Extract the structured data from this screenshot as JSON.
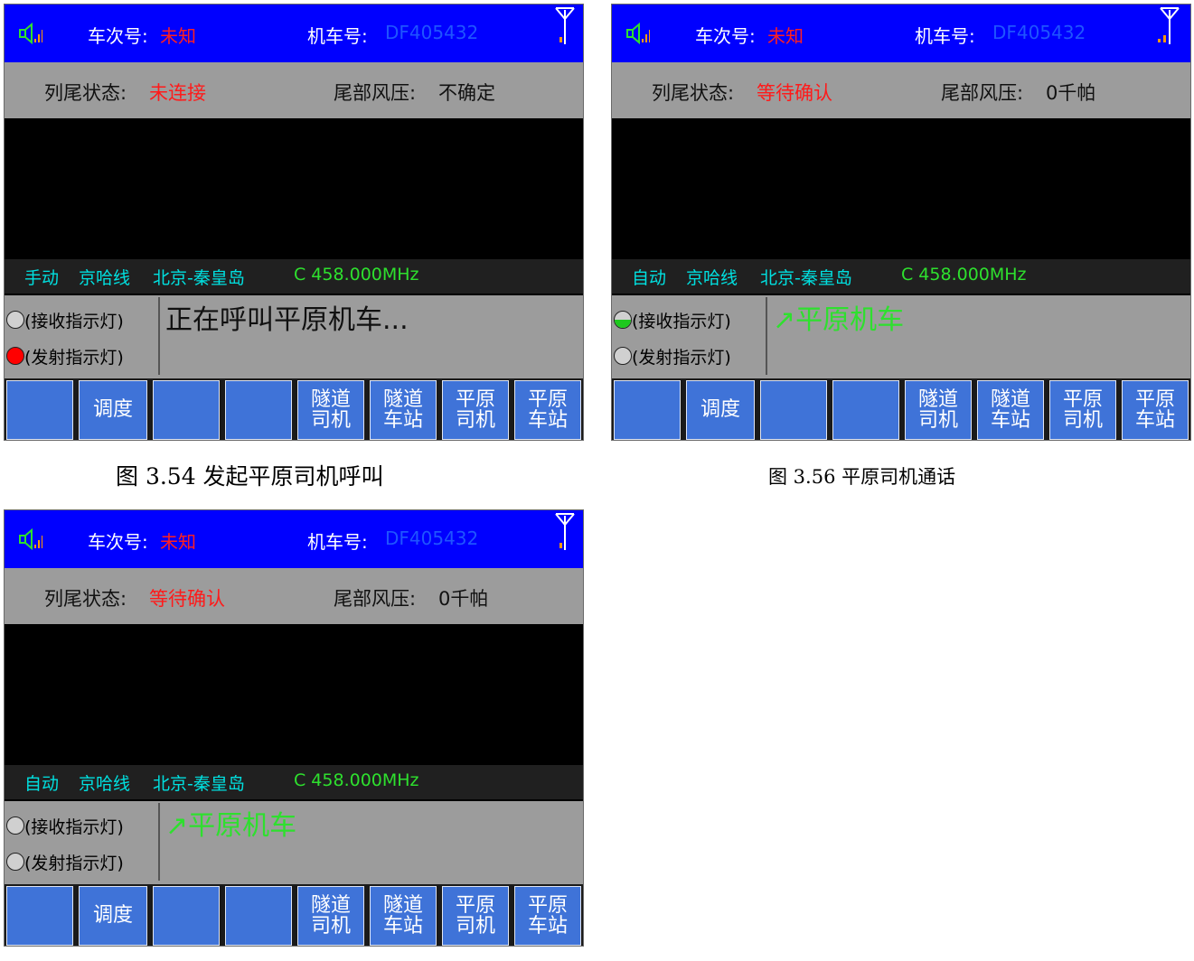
{
  "screens": [
    {
      "speaker_icon": "speaker-icon",
      "signal_icon": "signal-bars-icon",
      "antenna_icon": "antenna-icon",
      "train_label": "车次号:",
      "train_value": "未知",
      "loco_label": "机车号:",
      "loco_value": "DF405432",
      "tail_status_label": "列尾状态:",
      "tail_status_value": "未连接",
      "tail_pressure_label": "尾部风压:",
      "tail_pressure_value": "不确定",
      "mode": "手动",
      "line": "京哈线",
      "section": "北京-秦皇岛",
      "frequency": "C 458.000MHz",
      "rx_label": "(接收指示灯)",
      "tx_label": "(发射指示灯)",
      "rx_state": "off",
      "tx_state": "on",
      "message": "正在呼叫平原机车...",
      "buttons": [
        "",
        "调度",
        "",
        "",
        "隧道\n司机",
        "隧道\n车站",
        "平原\n司机",
        "平原\n车站"
      ]
    },
    {
      "speaker_icon": "speaker-icon",
      "signal_icon": "signal-bars-icon",
      "antenna_icon": "antenna-icon",
      "train_label": "车次号:",
      "train_value": "未知",
      "loco_label": "机车号:",
      "loco_value": "DF405432",
      "tail_status_label": "列尾状态:",
      "tail_status_value": "等待确认",
      "tail_pressure_label": "尾部风压:",
      "tail_pressure_value": "0千帕",
      "mode": "自动",
      "line": "京哈线",
      "section": "北京-秦皇岛",
      "frequency": "C 458.000MHz",
      "rx_label": "(接收指示灯)",
      "tx_label": "(发射指示灯)",
      "rx_state": "half",
      "tx_state": "off",
      "message": "↗平原机车",
      "buttons": [
        "",
        "调度",
        "",
        "",
        "隧道\n司机",
        "隧道\n车站",
        "平原\n司机",
        "平原\n车站"
      ]
    },
    {
      "speaker_icon": "speaker-icon",
      "signal_icon": "signal-bars-icon",
      "antenna_icon": "antenna-icon",
      "train_label": "车次号:",
      "train_value": "未知",
      "loco_label": "机车号:",
      "loco_value": "DF405432",
      "tail_status_label": "列尾状态:",
      "tail_status_value": "等待确认",
      "tail_pressure_label": "尾部风压:",
      "tail_pressure_value": "0千帕",
      "mode": "自动",
      "line": "京哈线",
      "section": "北京-秦皇岛",
      "frequency": "C 458.000MHz",
      "rx_label": "(接收指示灯)",
      "tx_label": "(发射指示灯)",
      "rx_state": "off",
      "tx_state": "off",
      "message": "↗平原机车",
      "buttons": [
        "",
        "调度",
        "",
        "",
        "隧道\n司机",
        "隧道\n车站",
        "平原\n司机",
        "平原\n车站"
      ]
    }
  ],
  "captions": {
    "fig_354": "图 3.54  发起平原司机呼叫",
    "fig_356": "图 3.56  平原司机通话"
  },
  "colors": {
    "topbar": "#0000ff",
    "status_gray": "#9c9c9c",
    "button_blue": "#3f73d8",
    "alert_red": "#ff1a1a",
    "info_cyan": "#00e0e0",
    "info_green": "#2ee02e"
  }
}
